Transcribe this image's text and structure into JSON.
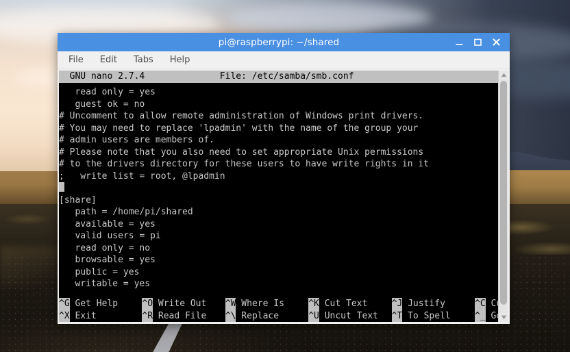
{
  "window": {
    "title": "pi@raspberrypi: ~/shared",
    "controls": [
      {
        "name": "minimize-button",
        "glyph": "_"
      },
      {
        "name": "maximize-button",
        "glyph": "square"
      },
      {
        "name": "close-button",
        "glyph": "x"
      }
    ],
    "accent_color": "#4a90e2",
    "menu": [
      "File",
      "Edit",
      "Tabs",
      "Help"
    ]
  },
  "nano": {
    "version_label": "GNU nano 2.7.4",
    "file_label": "File: /etc/samba/smb.conf",
    "header_line": "  GNU nano 2.7.4              File: /etc/samba/smb.conf",
    "terminal_bg": "#000000",
    "terminal_fg": "#c9c9c9",
    "reverse_bg": "#c0c0c0",
    "reverse_fg": "#000000",
    "lines": [
      "   read only = yes",
      "   guest ok = no",
      "# Uncomment to allow remote administration of Windows print drivers.",
      "# You may need to replace 'lpadmin' with the name of the group your",
      "# admin users are members of.",
      "# Please note that you also need to set appropriate Unix permissions",
      "# to the drivers directory for these users to have write rights in it",
      ";   write list = root, @lpadmin",
      "",
      "[share]",
      "   path = /home/pi/shared",
      "   available = yes",
      "   valid users = pi",
      "   read only = no",
      "   browsable = yes",
      "   public = yes",
      "   writable = yes"
    ],
    "cursor_line_index": 8,
    "cursor_column": 0,
    "shortcuts": [
      [
        {
          "key": "^G",
          "label": "Get Help"
        },
        {
          "key": "^O",
          "label": "Write Out"
        },
        {
          "key": "^W",
          "label": "Where Is"
        },
        {
          "key": "^K",
          "label": "Cut Text"
        },
        {
          "key": "^J",
          "label": "Justify"
        },
        {
          "key": "^C",
          "label": "Cur Pos"
        }
      ],
      [
        {
          "key": "^X",
          "label": "Exit"
        },
        {
          "key": "^R",
          "label": "Read File"
        },
        {
          "key": "^\\",
          "label": "Replace"
        },
        {
          "key": "^U",
          "label": "Uncut Text"
        },
        {
          "key": "^T",
          "label": "To Spell"
        },
        {
          "key": "^_",
          "label": "Go To Line"
        }
      ]
    ]
  },
  "scrollbar": {
    "up_arrow": "▲",
    "down_arrow": "▼"
  }
}
